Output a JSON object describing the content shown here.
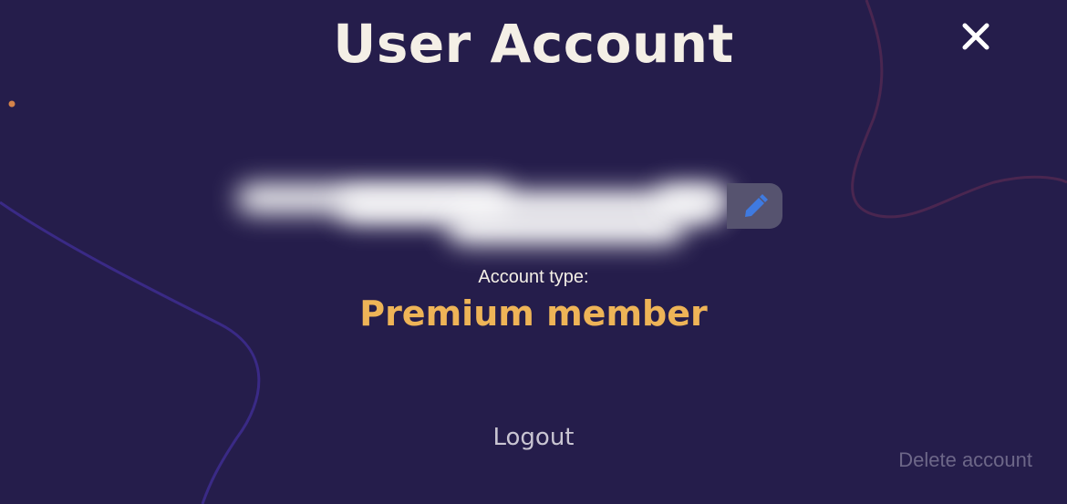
{
  "header": {
    "title": "User Account",
    "close_icon": "close-icon"
  },
  "profile": {
    "username_redacted": true,
    "edit_icon": "pencil-icon"
  },
  "account": {
    "type_label": "Account type:",
    "type_value": "Premium member"
  },
  "actions": {
    "logout_label": "Logout",
    "delete_label": "Delete account"
  },
  "colors": {
    "background": "#251d4b",
    "title_text": "#f4efe6",
    "accent_gold": "#eeb457",
    "edit_icon": "#3f7ae0",
    "edit_button_bg": "#56536f",
    "muted_text": "#6d6788",
    "decor_line_purple": "#3a2a86",
    "decor_line_red": "#4a2650",
    "decor_dot": "#d4834a"
  }
}
